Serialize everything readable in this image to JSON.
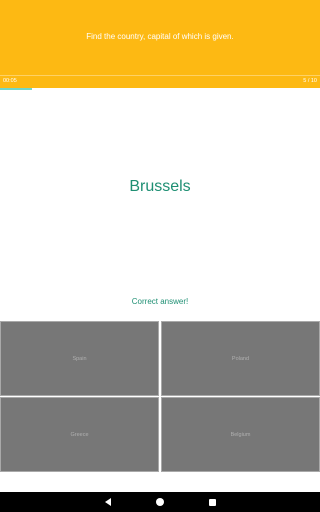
{
  "header": {
    "title": "Find the country, capital of which is given.",
    "background_color": "#fdb913"
  },
  "status": {
    "timer": "00:05",
    "counter": "5 / 10"
  },
  "progress": {
    "fraction": 0.1,
    "color": "#72d6c8"
  },
  "question": {
    "text": "Brussels"
  },
  "feedback": {
    "text": "Correct answer!"
  },
  "options": [
    {
      "label": "Spain"
    },
    {
      "label": "Poland"
    },
    {
      "label": "Greece"
    },
    {
      "label": "Belgium"
    }
  ],
  "navigation": {
    "back_icon": "back-triangle-icon",
    "home_icon": "home-circle-icon",
    "recent_icon": "recent-apps-square-icon"
  }
}
